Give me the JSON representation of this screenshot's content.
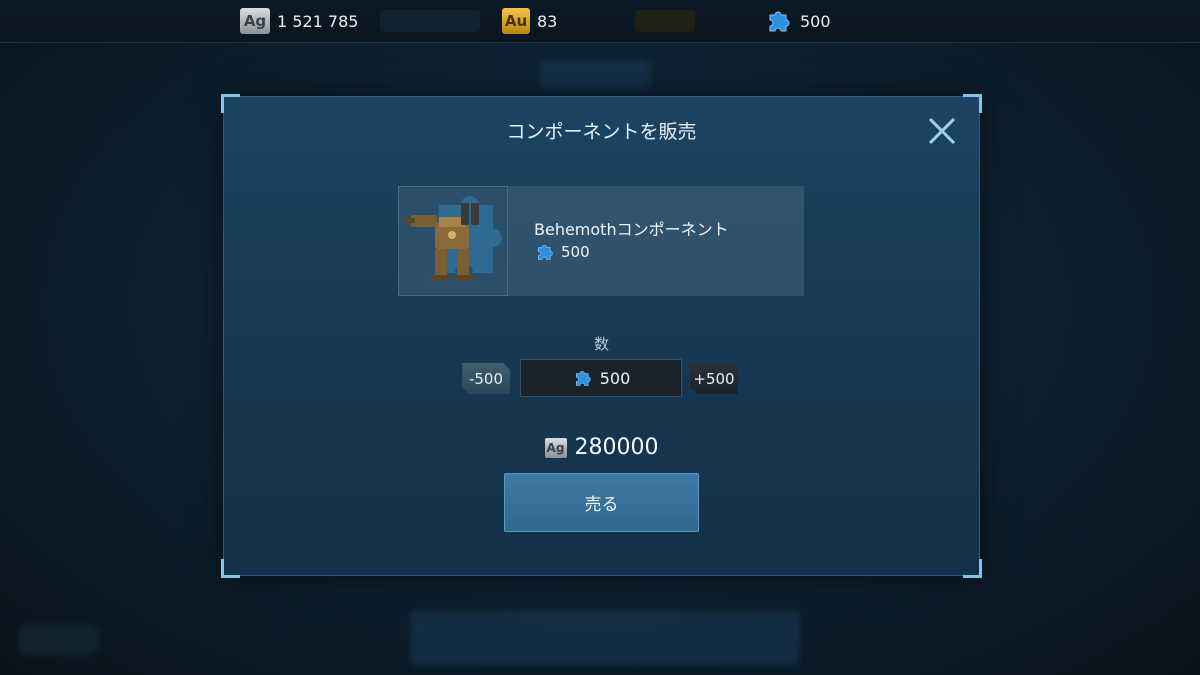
{
  "resources": {
    "silver": {
      "icon": "Ag",
      "value": "1 521 785"
    },
    "gold": {
      "icon": "Au",
      "value": "83"
    },
    "components": {
      "value": "500"
    }
  },
  "dialog": {
    "title": "コンポーネントを販売",
    "item": {
      "name": "Behemothコンポーネント",
      "count": "500"
    },
    "quantity": {
      "label": "数",
      "minus_label": "-500",
      "plus_label": "+500",
      "value": "500"
    },
    "price": {
      "icon": "Ag",
      "value": "280000"
    },
    "sell_label": "売る"
  },
  "colors": {
    "accent": "#7fc6ee",
    "sell_button": "#3f7aa4",
    "puzzle_icon": "#2f8fe0"
  }
}
